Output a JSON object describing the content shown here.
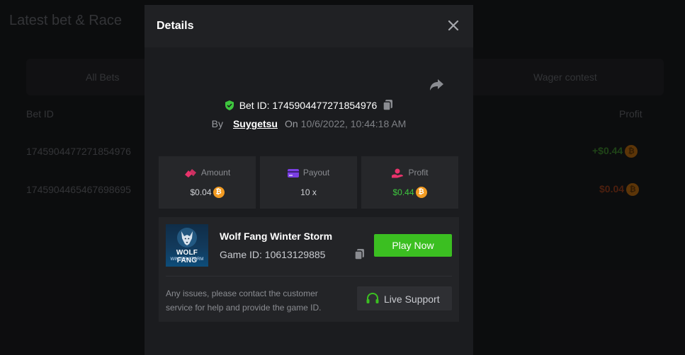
{
  "background": {
    "title": "Latest bet & Race",
    "tabs": [
      "All Bets",
      "Wager contest"
    ],
    "columns": [
      "Bet ID",
      "Profit"
    ],
    "rows": [
      {
        "bet_id": "1745904477271854976",
        "profit": "+$0.44",
        "profit_color": "#3a7a2a"
      },
      {
        "bet_id": "1745904465467698695",
        "profit": "$0.04",
        "profit_color": "#8a3a1a"
      }
    ]
  },
  "modal": {
    "title": "Details",
    "bet_id_label": "Bet ID: 1745904477271854976",
    "by_label": "By",
    "username": "Suygetsu",
    "on_label": "On",
    "datetime": "10/6/2022, 10:44:18 AM",
    "stats": [
      {
        "label": "Amount",
        "value": "$0.04",
        "icon": "bet-chips-icon",
        "color": "#e8336b"
      },
      {
        "label": "Payout",
        "value": "10 x",
        "icon": "card-icon",
        "color": "#7b3fe4"
      },
      {
        "label": "Profit",
        "value": "$0.44",
        "icon": "profit-hand-icon",
        "color": "#e8336b"
      }
    ],
    "game": {
      "name": "Wolf Fang Winter Storm",
      "id_label": "Game ID: 10613129885",
      "thumb_line1": "WOLF FANG",
      "thumb_line2": "WINTER STORM",
      "play_label": "Play Now"
    },
    "support_text": "Any issues, please contact the customer service for help and provide the game ID.",
    "support_label": "Live Support"
  },
  "colors": {
    "accent_green": "#3bbf21",
    "profit_green": "#3ec63e",
    "coin": "#f29b22"
  }
}
